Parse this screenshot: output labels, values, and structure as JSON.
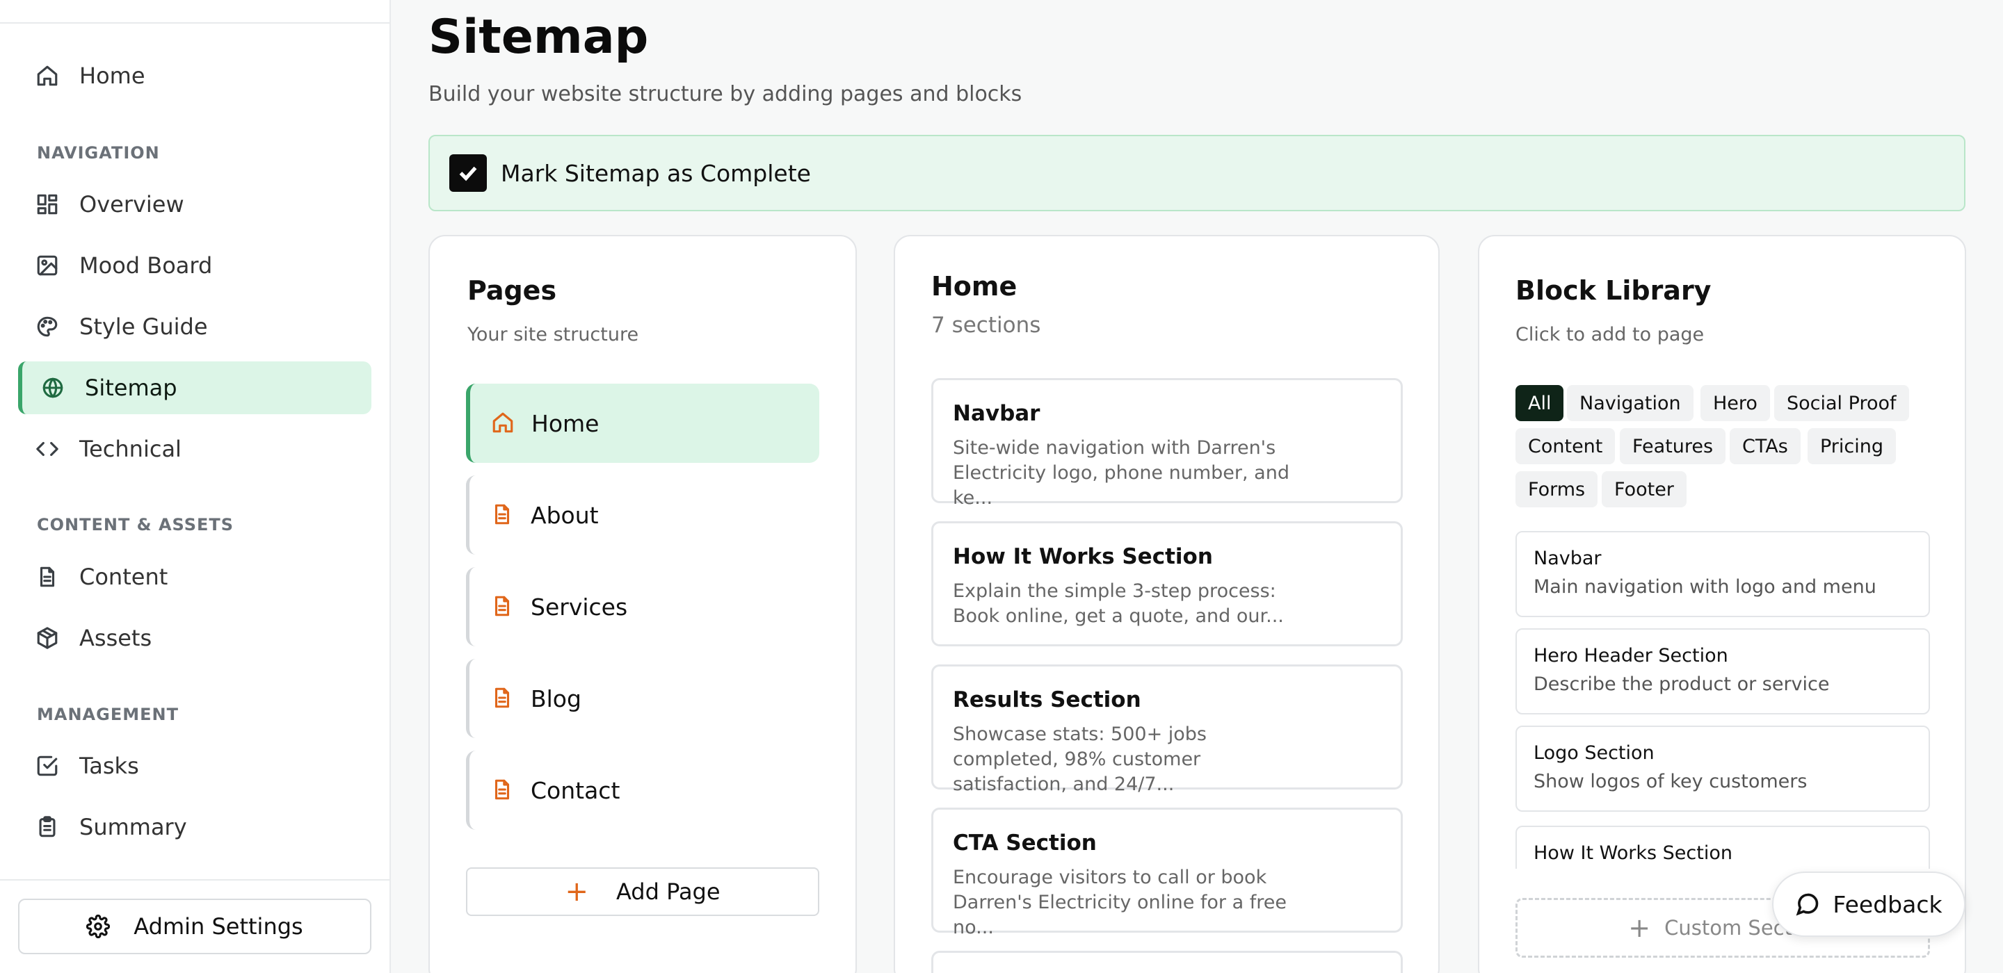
{
  "sidebar": {
    "home_label": "Home",
    "sections": {
      "navigation": "NAVIGATION",
      "content_assets": "CONTENT & ASSETS",
      "management": "MANAGEMENT"
    },
    "items": {
      "overview": "Overview",
      "mood_board": "Mood Board",
      "style_guide": "Style Guide",
      "sitemap": "Sitemap",
      "technical": "Technical",
      "content": "Content",
      "assets": "Assets",
      "tasks": "Tasks",
      "summary": "Summary"
    },
    "admin_label": "Admin Settings"
  },
  "header": {
    "title": "Sitemap",
    "subtitle": "Build your website structure by adding pages and blocks"
  },
  "complete_bar": {
    "label": "Mark Sitemap as Complete",
    "checked": true
  },
  "pages_panel": {
    "title": "Pages",
    "subtitle": "Your site structure",
    "pages": [
      "Home",
      "About",
      "Services",
      "Blog",
      "Contact"
    ],
    "add_label": "Add Page"
  },
  "page_detail": {
    "title": "Home",
    "count": "7 sections",
    "sections": [
      {
        "title": "Navbar",
        "desc": "Site-wide navigation with Darren's Electricity logo, phone number, and ke..."
      },
      {
        "title": "How It Works Section",
        "desc": "Explain the simple 3-step process: Book online, get a quote, and our..."
      },
      {
        "title": "Results Section",
        "desc": "Showcase stats: 500+ jobs completed, 98% customer satisfaction, and 24/7..."
      },
      {
        "title": "CTA Section",
        "desc": "Encourage visitors to call or book Darren's Electricity online for a free no..."
      }
    ]
  },
  "block_library": {
    "title": "Block Library",
    "subtitle": "Click to add to page",
    "filters": [
      "All",
      "Navigation",
      "Hero",
      "Social Proof",
      "Content",
      "Features",
      "CTAs",
      "Pricing",
      "Forms",
      "Footer"
    ],
    "blocks": [
      {
        "title": "Navbar",
        "desc": "Main navigation with logo and menu"
      },
      {
        "title": "Hero Header Section",
        "desc": "Describe the product or service"
      },
      {
        "title": "Logo Section",
        "desc": "Show logos of key customers"
      },
      {
        "title": "How It Works Section",
        "desc": ""
      }
    ],
    "custom_label": "Custom Secti..."
  },
  "feedback_label": "Feedback",
  "colors": {
    "accent_green": "#3aa56a",
    "active_bg": "#dcf5e7",
    "page_icon_orange": "#e0661a"
  }
}
